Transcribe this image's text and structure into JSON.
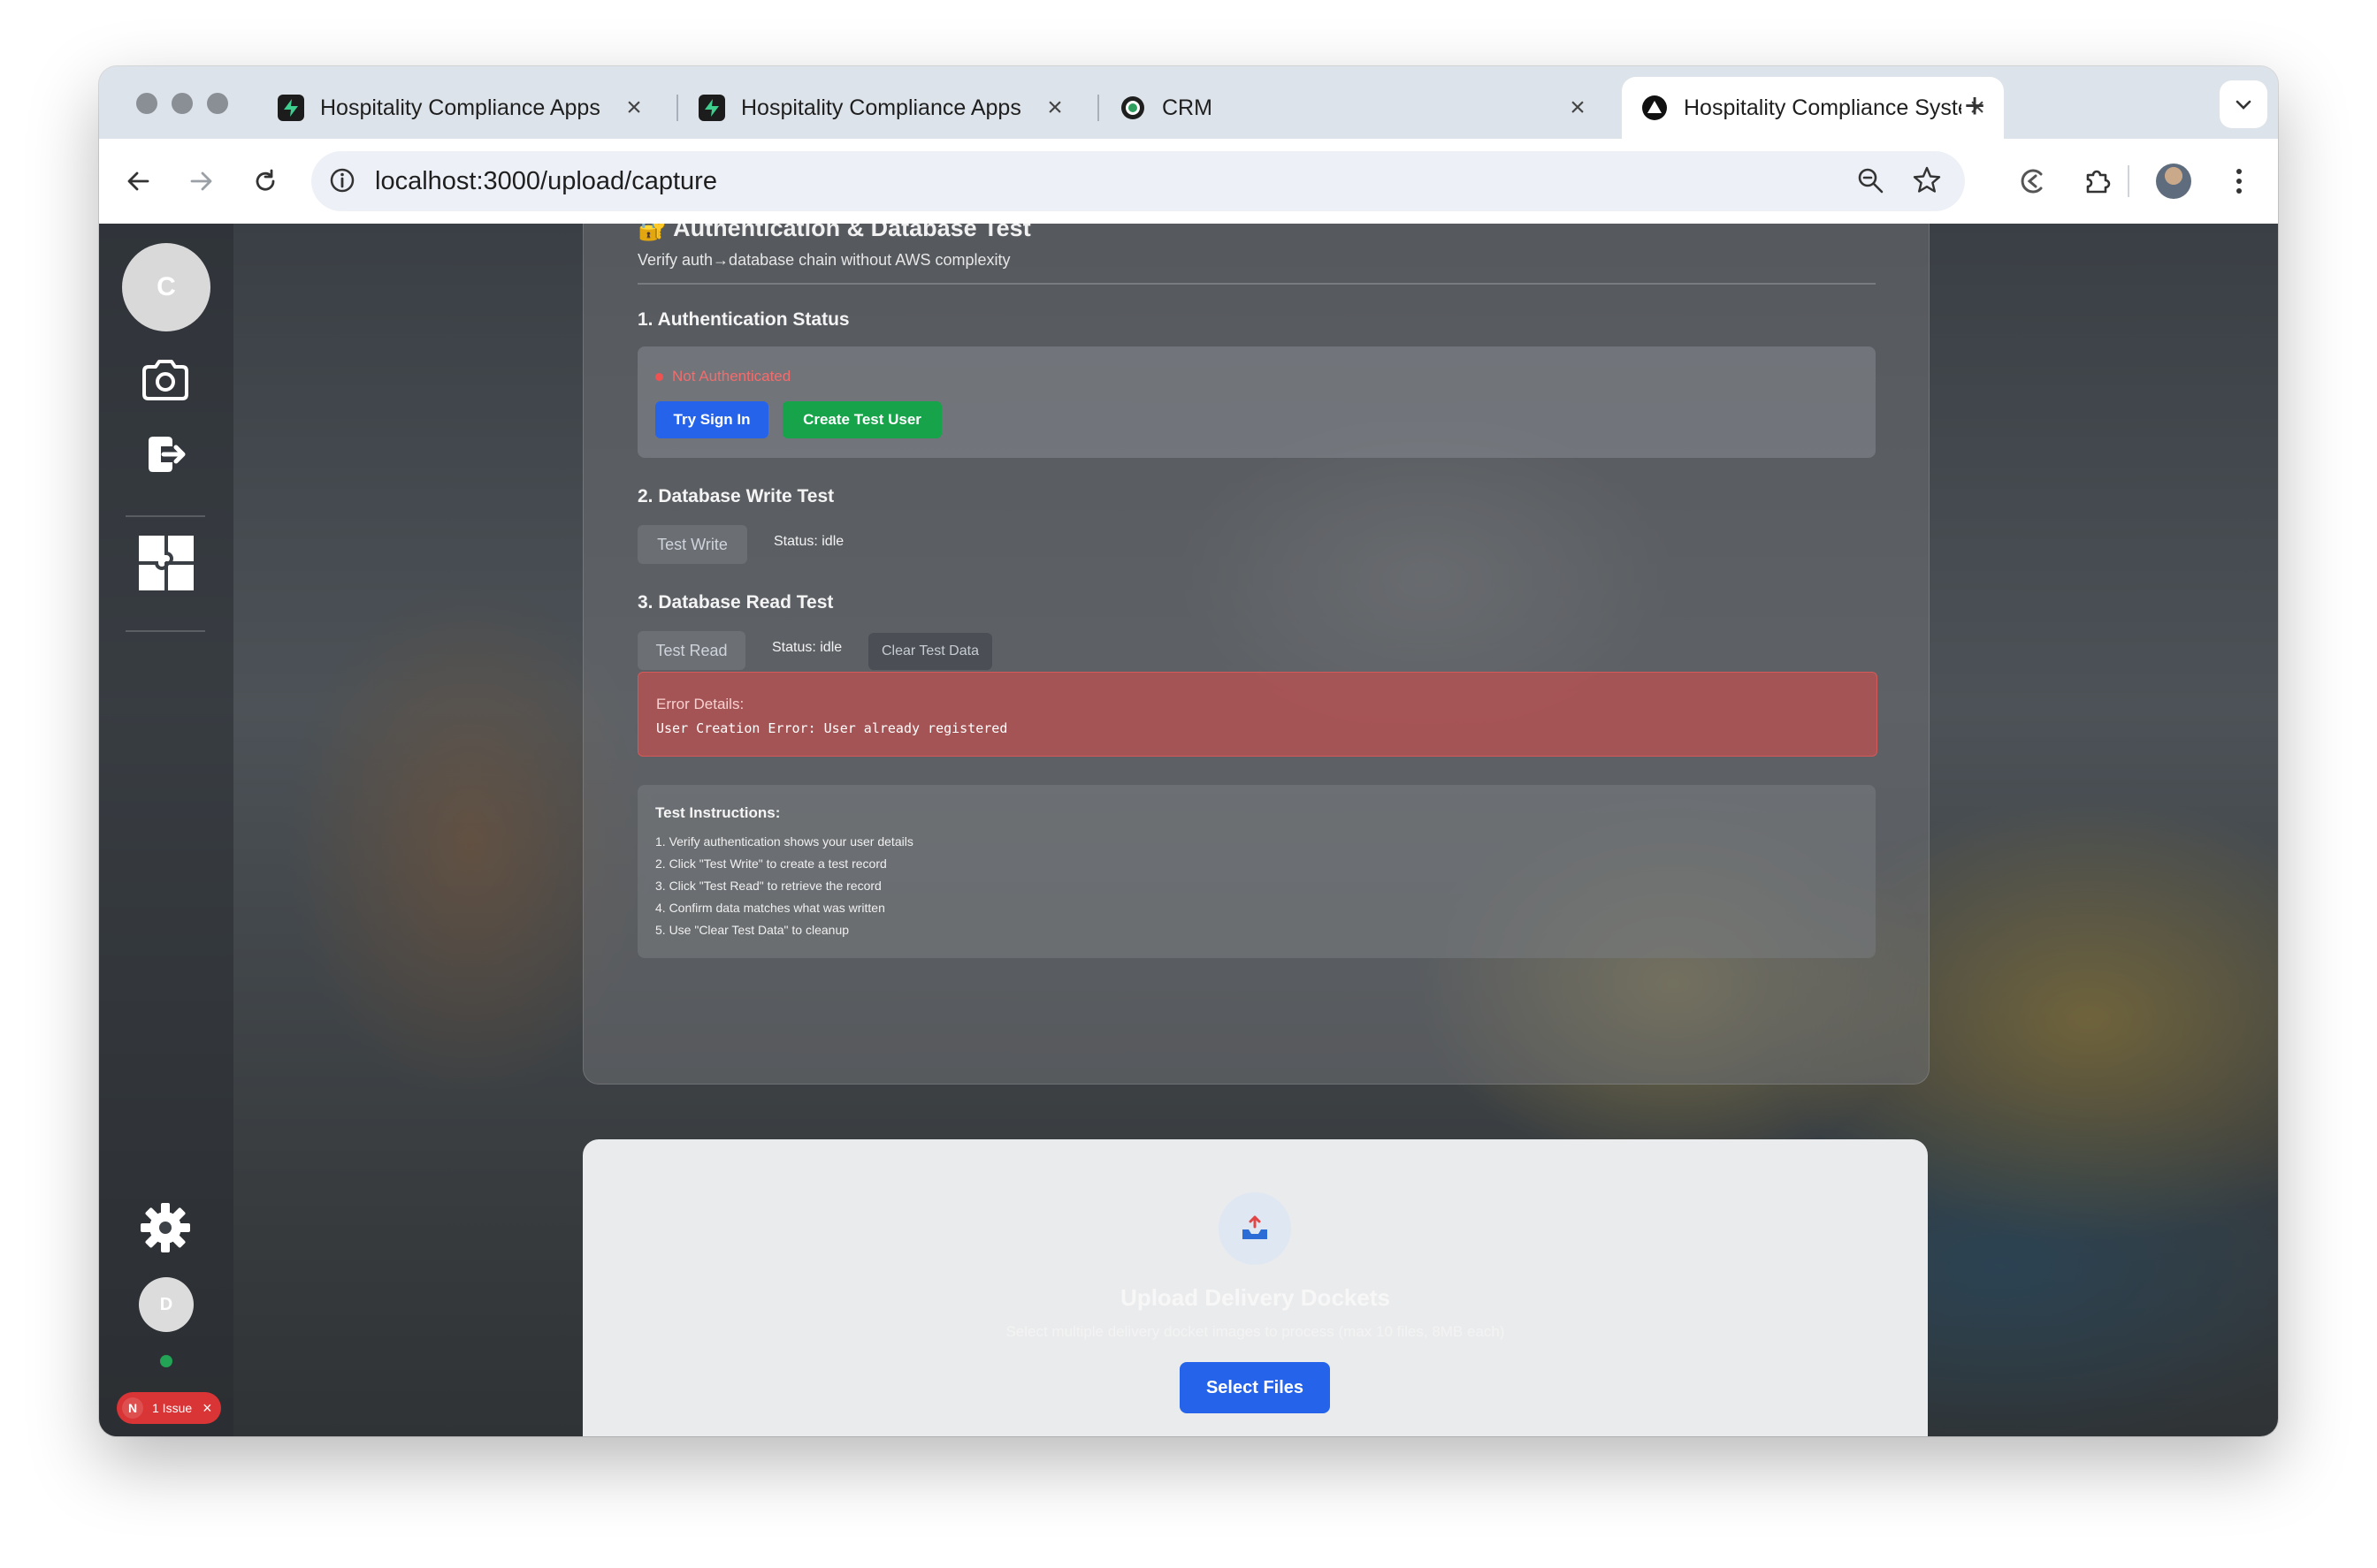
{
  "browser": {
    "tabs": [
      {
        "title": "Hospitality Compliance Apps",
        "favicon": "supabase-icon",
        "active": false
      },
      {
        "title": "Hospitality Compliance Apps",
        "favicon": "supabase-icon",
        "active": false
      },
      {
        "title": "CRM",
        "favicon": "crm-icon",
        "active": false
      },
      {
        "title": "Hospitality Compliance Syste",
        "favicon": "vercel-icon",
        "active": true
      }
    ],
    "url": "localhost:3000/upload/capture"
  },
  "sidebar": {
    "avatar_initial": "C",
    "user_initial": "D",
    "issue_badge": "1 Issue",
    "issue_logo": "N"
  },
  "test_card": {
    "title": "🔐 Authentication & Database Test",
    "subtitle": "Verify auth→database chain without AWS complexity",
    "section1": "1. Authentication Status",
    "auth_status": "Not Authenticated",
    "try_sign_in": "Try Sign In",
    "create_test_user": "Create Test User",
    "section2": "2. Database Write Test",
    "test_write": "Test Write",
    "write_status": "Status: idle",
    "section3": "3. Database Read Test",
    "test_read": "Test Read",
    "read_status": "Status: idle",
    "clear_test_data": "Clear Test Data",
    "error_label": "Error Details:",
    "error_message": "User Creation Error: User already registered",
    "instructions_label": "Test Instructions:",
    "instructions": [
      "1. Verify authentication shows your user details",
      "2. Click \"Test Write\" to create a test record",
      "3. Click \"Test Read\" to retrieve the record",
      "4. Confirm data matches what was written",
      "5. Use \"Clear Test Data\" to cleanup"
    ]
  },
  "upload": {
    "title": "Upload Delivery Dockets",
    "subtitle": "Select multiple delivery docket images to process (max 10 files, 8MB each)",
    "button": "Select Files"
  },
  "colors": {
    "primary": "#2563eb",
    "success": "#16a34a",
    "error": "#f05252"
  }
}
